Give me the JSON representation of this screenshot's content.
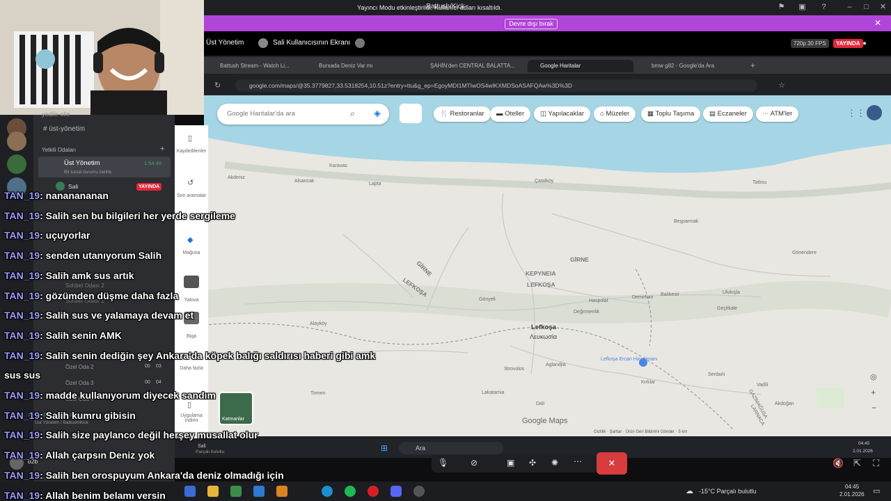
{
  "window": {
    "title": "Battush/Kick"
  },
  "notice": {
    "text": "Yayıncı Modu etkinleştirildi. Kullanıcı adları kısaltıldı.",
    "button": "Devre dışı bırak"
  },
  "stream": {
    "channel": "Üst Yönetim",
    "screen_owner": "Sali Kullanıcısının Ekranı",
    "quality": "720p 30 FPS",
    "live_badge": "YAYINDA"
  },
  "sidebar": {
    "items": [
      {
        "label": "yedile-olle"
      },
      {
        "label": "üst-yönetim"
      }
    ],
    "category": "Yetkili Odaları",
    "voice_channel": {
      "label": "Üst Yönetim",
      "time": "1:54:49",
      "status": "Bir kanal durumu belirle"
    },
    "member": {
      "label": "Sali",
      "badge": "YAYINDA"
    },
    "rooms": [
      "Sohbet Odası 2",
      "Sohbet Odası 1",
      "Özel Oda 2",
      "Özel Oda 3",
      "Özel Oda 4"
    ],
    "room_counts": [
      "00",
      "03",
      "00",
      "04"
    ],
    "voice_footer": {
      "label": "Ses Bağlantısı Kuruldu",
      "sub": "Üst Yönetim / Battush/Kick"
    },
    "user": {
      "name": "b2b"
    }
  },
  "browser": {
    "tabs": [
      {
        "label": "Battush Stream - Watch Li..."
      },
      {
        "label": "Bursada Deniz Var mı"
      },
      {
        "label": "ŞAHİN'den CENTRAL BALATTA..."
      },
      {
        "label": "Google Haritalar"
      },
      {
        "label": "bmw g82 - Google'da Ara"
      }
    ],
    "url": "google.com/maps/@35.3779827,33.5318254,10.51z?entry=ttu&g_ep=EgoyMDI1MTIwOS4wIKXMDSoASAFQAw%3D%3D"
  },
  "maps": {
    "search_placeholder": "Google Haritalar'da ara",
    "chips": [
      "Restoranlar",
      "Oteller",
      "Yapılacaklar",
      "Müzeler",
      "Toplu Taşıma",
      "Eczaneler",
      "ATM'ler"
    ],
    "rail": [
      "Kaydedilenler",
      "Son aramalar",
      "Mağusa",
      "Yalova",
      "Biga",
      "Daha fazla",
      "Uygulama indirin"
    ],
    "layers": "Katmanlar",
    "brand": "Google Maps",
    "places": {
      "lefkosa": "Lefkoşa",
      "lefkosia": "Λευκωσία",
      "kyrenia": "KEPYNEIA",
      "kyrenia2": "LEFKOŞA",
      "girne": "GİRNE",
      "girne2": "GİRNE",
      "lefkosa_region": "LEFKOŞA",
      "ercan": "Lefkoşa Ercan Havalimanı",
      "karavas": "Karavas",
      "lapta": "Lapta",
      "alsancak": "Alsancak",
      "akdeniz": "Akdeniz",
      "catalkoy": "Çatalköy",
      "besparmak": "Beşparmak",
      "degirmenlik": "Değirmenlik",
      "tatlisu": "Tatlısu",
      "alaykoy": "Alayköy",
      "gonyeli": "Gönyeli",
      "haspolat": "Haspolat",
      "balikesir": "Balıkesir",
      "demirhan": "Demirhan",
      "gecitkale": "Geçitkale",
      "gonendere": "Gönendere",
      "ulukisla": "Ulukışla",
      "akdogan": "Akdoğan",
      "vadili": "Vadili",
      "tirmen": "Tirmen",
      "strovolos": "Strovolos",
      "aglandjia": "Aglandjia",
      "lakatamia": "Lakatamia",
      "dali": "Dali",
      "kiklas": "Kırklar",
      "serdarli": "Serdarlı",
      "gazimagusa": "GAZİMAĞUSA",
      "larnaca": "LARNACA"
    },
    "footer": "Gizlilik · Şartlar · Ürün Geri Bildirimi Gönder · 5 km"
  },
  "inner_taskbar": {
    "search": "Ara",
    "window_label": "Sali",
    "window_sub": "Parçalı bulutlu",
    "clock_time": "04:45",
    "clock_date": "2.01.2026"
  },
  "taskbar": {
    "weather": "-15°C  Parçalı bulutlu",
    "time": "04:45",
    "date": "2.01.2026"
  },
  "chat": [
    {
      "user": "TAN_19",
      "text": ": nananananan"
    },
    {
      "user": "TAN_19",
      "text": ": Salih sen bu bilgileri her yerde sergileme"
    },
    {
      "user": "TAN_19",
      "text": ": uçuyorlar"
    },
    {
      "user": "TAN_19",
      "text": ": senden utanıyorum Salih"
    },
    {
      "user": "TAN_19",
      "text": ": Salih amk sus artık"
    },
    {
      "user": "TAN_19",
      "text": ": gözümden düşme daha fazla"
    },
    {
      "user": "TAN_19",
      "text": ": Salih sus ve yalamaya devam et"
    },
    {
      "user": "TAN_19",
      "text": ": Salih senin AMK"
    },
    {
      "user": "TAN_19",
      "text": ": Salih senin dediğin şey Ankara'da köpek balığı saldırısı haberi gibi amk"
    },
    {
      "user": "",
      "text": "sus sus"
    },
    {
      "user": "TAN_19",
      "text": ": madde kullanıyorum diyecek sandım"
    },
    {
      "user": "TAN_19",
      "text": ": Salih kumru gibisin"
    },
    {
      "user": "TAN_19",
      "text": ": Salih size paylanco değil herşey musallat olur"
    },
    {
      "user": "TAN_19",
      "text": ": Allah çarpsın Deniz yok"
    },
    {
      "user": "TAN_19",
      "text": ": Salih ben orospuyum Ankara'da deniz olmadığı için"
    },
    {
      "user": "TAN_19",
      "text": ": Allah benim belamı versin"
    }
  ],
  "colors": {
    "accent": "#b144d9",
    "live": "#e3263a",
    "chat_name": "#9c9fff",
    "map_sea": "#8fcfe3",
    "map_land": "#e9e7e1"
  }
}
